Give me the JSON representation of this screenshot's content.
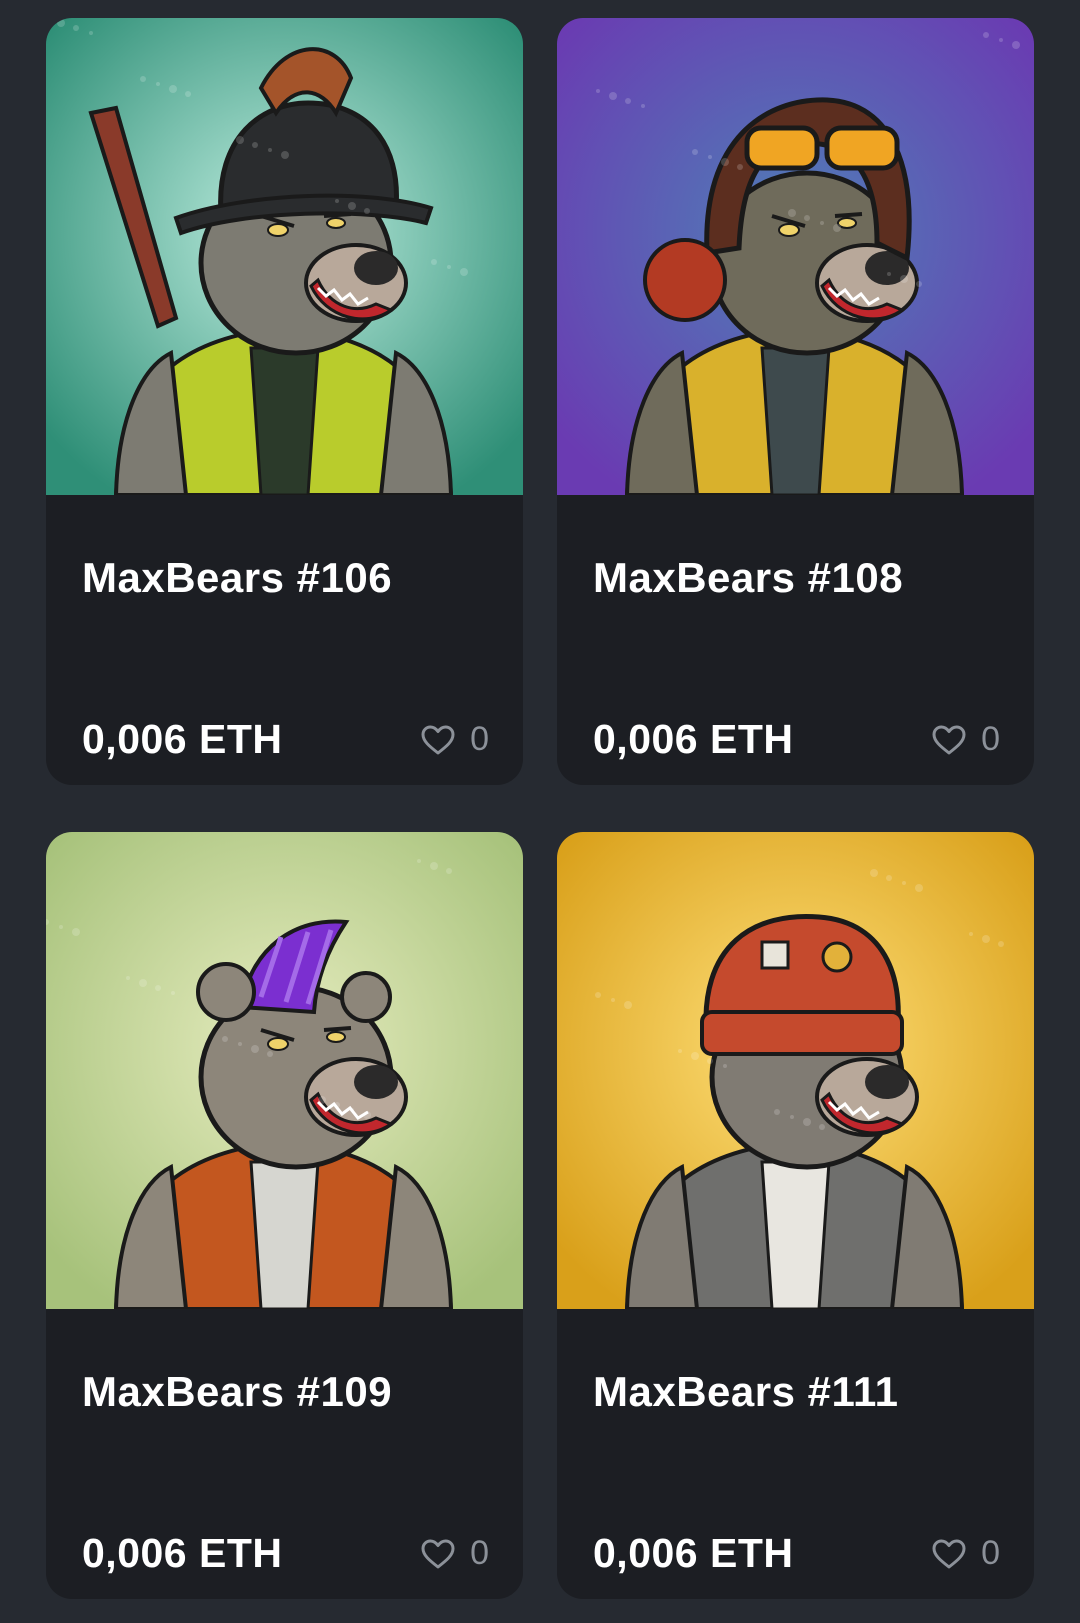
{
  "items": [
    {
      "title": "MaxBears #106",
      "price": "0,006 ETH",
      "likes": "0",
      "art": {
        "bg_inner": "#bfeee0",
        "bg_outer": "#2f8f77",
        "hat": "#2a2c2e",
        "hat_accent": "#a4542a",
        "fur": "#7d7b72",
        "outfit": "#b9cc2c",
        "outfit_dark": "#2b3a2a"
      }
    },
    {
      "title": "MaxBears #108",
      "price": "0,006 ETH",
      "likes": "0",
      "art": {
        "bg_inner": "#4f7fb7",
        "bg_outer": "#6a3bb2",
        "hat": "#5c2e1f",
        "hat_accent": "#f0a523",
        "fur": "#6f6b5b",
        "outfit": "#d9b12c",
        "outfit_dark": "#3e4a4d"
      }
    },
    {
      "title": "MaxBears #109",
      "price": "0,006 ETH",
      "likes": "0",
      "art": {
        "bg_inner": "#e6ecbf",
        "bg_outer": "#a7c27b",
        "hat": "#7b2fd0",
        "hat_accent": "#a46be8",
        "fur": "#8d867a",
        "outfit": "#c3571f",
        "outfit_dark": "#d6d6d0"
      }
    },
    {
      "title": "MaxBears #111",
      "price": "0,006 ETH",
      "likes": "0",
      "art": {
        "bg_inner": "#ffe07a",
        "bg_outer": "#d9a01a",
        "hat": "#c54a2d",
        "hat_accent": "#e2b13a",
        "fur": "#807b73",
        "outfit": "#6f6f6d",
        "outfit_dark": "#e8e6e0"
      }
    }
  ],
  "icons": {
    "like": "heart-icon"
  }
}
